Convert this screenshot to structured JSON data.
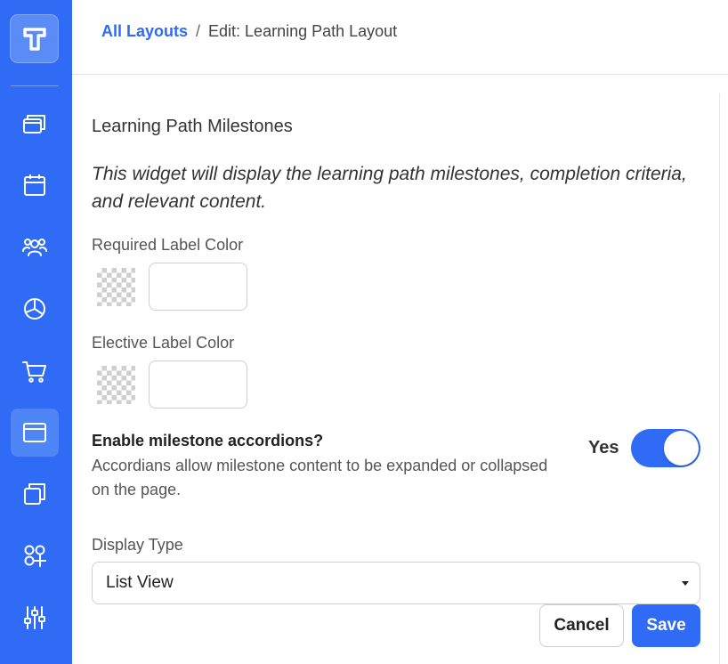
{
  "breadcrumb": {
    "link": "All Layouts",
    "separator": "/",
    "current": "Edit: Learning Path Layout"
  },
  "sidebar": {
    "items": [
      {
        "icon": "windows-icon"
      },
      {
        "icon": "calendar-icon"
      },
      {
        "icon": "users-icon"
      },
      {
        "icon": "pie-chart-icon"
      },
      {
        "icon": "cart-icon"
      },
      {
        "icon": "layout-icon",
        "active": true
      },
      {
        "icon": "copy-icon"
      },
      {
        "icon": "apps-add-icon"
      },
      {
        "icon": "sliders-icon"
      }
    ]
  },
  "widget": {
    "title": "Learning Path Milestones",
    "description": "This widget will display the learning path milestones, completion criteria, and relevant content.",
    "required_label": "Required Label Color",
    "required_value": "",
    "elective_label": "Elective Label Color",
    "elective_value": "",
    "accordion_title": "Enable milestone accordions?",
    "accordion_desc": "Accordians allow milestone content to be expanded or collapsed on the page.",
    "accordion_state": "Yes",
    "display_type_label": "Display Type",
    "display_type_value": "List View"
  },
  "actions": {
    "cancel": "Cancel",
    "save": "Save"
  },
  "colors": {
    "brand": "#2f6bf4",
    "sidebar": "#2f6bf4"
  }
}
